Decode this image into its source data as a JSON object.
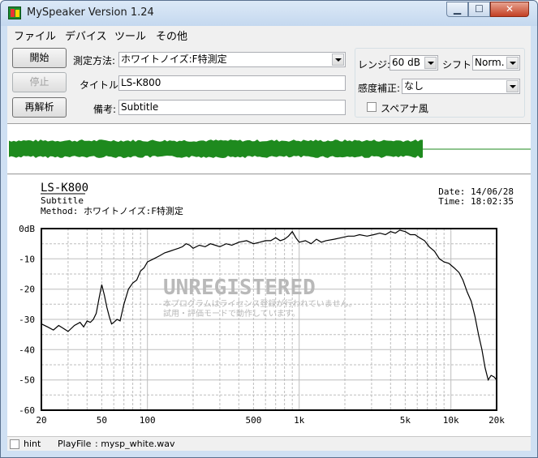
{
  "window": {
    "title": "MySpeaker Version 1.24"
  },
  "menu": [
    "ファイル",
    "デバイス",
    "ツール",
    "その他"
  ],
  "buttons": {
    "start": "開始",
    "stop": "停止",
    "reanalyze": "再解析"
  },
  "form": {
    "method_label": "測定方法:",
    "method_value": "ホワイトノイズ:F特測定",
    "title_label": "タイトル:",
    "title_value": "LS-K800",
    "note_label": "備考:",
    "note_value": "Subtitle"
  },
  "settings": {
    "range_label": "レンジ:",
    "range_value": "60 dB",
    "shift_label": "シフト:",
    "shift_value": "Norm.",
    "sensitivity_label": "感度補正:",
    "sensitivity_value": "なし",
    "spectrum_label": "スペアナ風",
    "spectrum_checked": false
  },
  "report": {
    "title": "LS-K800",
    "subtitle": "Subtitle",
    "method_line": "Method:  ホワイトノイズ:F特測定",
    "date_line": "Date: 14/06/28",
    "time_line": "Time: 18:02:35"
  },
  "watermark": {
    "line1": "UNREGISTERED",
    "line2": "本プログラムはライセンス登録が行われていません。",
    "line3": "試用・評価モードで動作しています。"
  },
  "status": {
    "hint_label": "hint",
    "playfile_label": "PlayFile",
    "playfile_value": ": mysp_white.wav"
  },
  "colors": {
    "waveform": "#1e8a1e",
    "curve": "#000000",
    "grid": "#bdbdbd"
  },
  "chart_data": {
    "type": "line",
    "xscale": "log",
    "xlim": [
      20,
      20000
    ],
    "ylim": [
      -60,
      0
    ],
    "xticks": [
      "20",
      "50",
      "100",
      "500",
      "1k",
      "5k",
      "10k",
      "20k"
    ],
    "xtick_values": [
      20,
      50,
      100,
      500,
      1000,
      5000,
      10000,
      20000
    ],
    "yticks": [
      "0dB",
      "-10",
      "-20",
      "-30",
      "-40",
      "-50",
      "-60"
    ],
    "ytick_values": [
      0,
      -10,
      -20,
      -30,
      -40,
      -50,
      -60
    ],
    "grid": true,
    "series": [
      {
        "x": [
          20,
          22,
          24,
          26,
          28,
          30,
          33,
          36,
          38,
          40,
          42,
          44,
          46,
          48,
          50,
          52,
          54,
          56,
          58,
          60,
          63,
          66,
          70,
          75,
          80,
          85,
          90,
          95,
          100,
          110,
          120,
          130,
          140,
          150,
          160,
          170,
          180,
          190,
          200,
          220,
          240,
          260,
          280,
          300,
          330,
          360,
          400,
          450,
          500,
          550,
          600,
          650,
          700,
          750,
          800,
          850,
          900,
          950,
          1000,
          1100,
          1200,
          1300,
          1400,
          1500,
          1700,
          1900,
          2100,
          2300,
          2500,
          2800,
          3100,
          3400,
          3700,
          4000,
          4300,
          4600,
          5000,
          5400,
          5800,
          6200,
          6700,
          7200,
          7800,
          8400,
          9000,
          9700,
          10500,
          11300,
          12000,
          12800,
          13600,
          14400,
          15200,
          16000,
          16800,
          17600,
          18400,
          19200,
          20000
        ],
        "y": [
          -31.5,
          -32.5,
          -33.5,
          -32,
          -33,
          -34,
          -32,
          -31,
          -32.5,
          -30.5,
          -31,
          -30,
          -28,
          -23,
          -18.5,
          -22,
          -26,
          -29,
          -31.5,
          -31,
          -30,
          -30.5,
          -25,
          -20,
          -18,
          -17,
          -14,
          -13,
          -11,
          -10,
          -9,
          -8,
          -7.5,
          -7,
          -6.5,
          -6,
          -5,
          -5.5,
          -6.5,
          -5.5,
          -6,
          -5,
          -5.5,
          -6,
          -5,
          -5.5,
          -4.5,
          -4,
          -5,
          -4.5,
          -4,
          -4,
          -3,
          -4,
          -3.5,
          -2.5,
          -1,
          -3,
          -4.5,
          -4,
          -5,
          -3.5,
          -4.5,
          -4,
          -3.5,
          -3,
          -2.5,
          -2.5,
          -2,
          -2.5,
          -2,
          -1.5,
          -2,
          -1,
          -1.5,
          -0.5,
          -1,
          -2,
          -2,
          -3,
          -4,
          -6,
          -7.5,
          -10,
          -11,
          -11.5,
          -13,
          -14.5,
          -17,
          -21,
          -24,
          -29,
          -35,
          -40,
          -46,
          -50,
          -48.5,
          -49,
          -50
        ]
      }
    ]
  }
}
